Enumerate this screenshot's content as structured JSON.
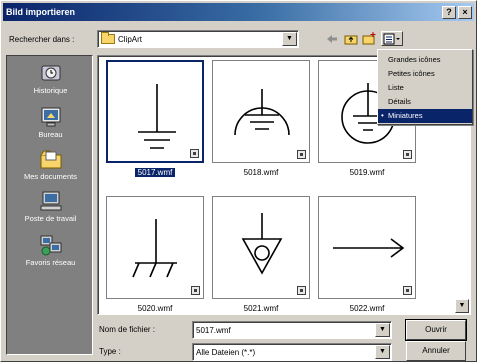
{
  "window": {
    "title": "Bild importieren",
    "help_label": "?",
    "close_label": "×"
  },
  "lookin": {
    "label": "Rechercher dans :",
    "value": "ClipArt",
    "dropdown_glyph": "▼"
  },
  "toolbar": {
    "back_icon": "back-arrow-icon",
    "up_icon": "up-folder-icon",
    "new_folder_icon": "new-folder-icon",
    "views_icon": "views-menu-icon"
  },
  "places": {
    "items": [
      {
        "label": "Historique",
        "icon": "history-icon"
      },
      {
        "label": "Bureau",
        "icon": "desktop-icon"
      },
      {
        "label": "Mes documents",
        "icon": "my-documents-icon"
      },
      {
        "label": "Poste de travail",
        "icon": "my-computer-icon"
      },
      {
        "label": "Favoris réseau",
        "icon": "network-places-icon"
      }
    ]
  },
  "files": [
    {
      "name": "5017.wmf",
      "symbol": "ground",
      "selected": true
    },
    {
      "name": "5018.wmf",
      "symbol": "ground-arc",
      "selected": false
    },
    {
      "name": "5019.wmf",
      "symbol": "ground-circle",
      "selected": false
    },
    {
      "name": "5020.wmf",
      "symbol": "chassis-ground",
      "selected": false
    },
    {
      "name": "5021.wmf",
      "symbol": "triangle-ground",
      "selected": false
    },
    {
      "name": "5022.wmf",
      "symbol": "arrow",
      "selected": false
    }
  ],
  "views_menu": {
    "items": [
      {
        "label": "Grandes icônes",
        "checked": false
      },
      {
        "label": "Petites icônes",
        "checked": false
      },
      {
        "label": "Liste",
        "checked": false
      },
      {
        "label": "Détails",
        "checked": false
      },
      {
        "label": "Miniatures",
        "checked": true
      }
    ],
    "check_glyph": "•"
  },
  "filename": {
    "label": "Nom de fichier :",
    "value": "5017.wmf"
  },
  "filetype": {
    "label": "Type :",
    "value": "Alle Dateien (*.*)"
  },
  "buttons": {
    "open": "Ouvrir",
    "cancel": "Annuler"
  },
  "scrollbar": {
    "down_glyph": "▼"
  },
  "colors": {
    "title_active": "#0a246a",
    "face": "#d4d0c8",
    "places_bg": "#808080",
    "selection": "#0a246a"
  }
}
